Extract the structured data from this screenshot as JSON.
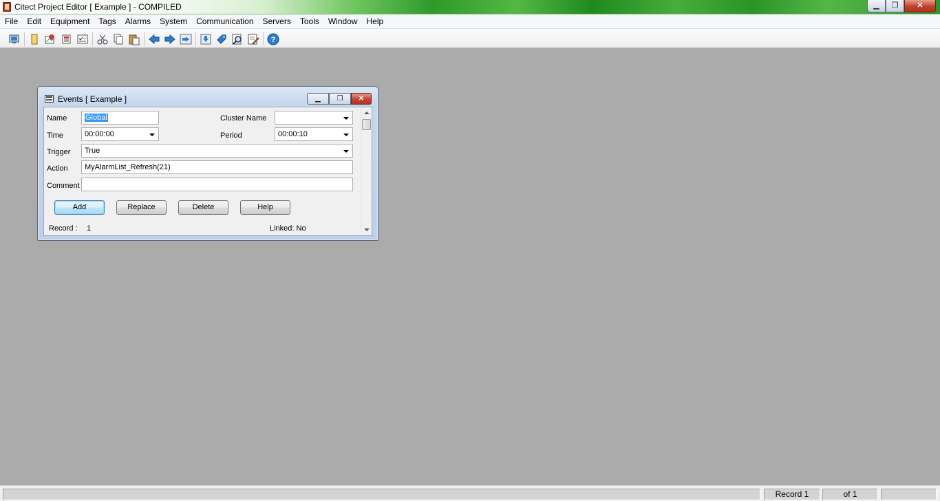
{
  "window": {
    "title": "Citect Project Editor [ Example ] - COMPILED",
    "minimize": "▁",
    "restore": "❐",
    "close": "✕"
  },
  "menu": [
    "File",
    "Edit",
    "Equipment",
    "Tags",
    "Alarms",
    "System",
    "Communication",
    "Servers",
    "Tools",
    "Window",
    "Help"
  ],
  "toolbar": {
    "buttons": [
      "explorer-icon",
      "open-project-icon",
      "graphics-builder-icon",
      "pack-icon",
      "compile-icon",
      "cut-icon",
      "copy-icon",
      "paste-icon",
      "back-arrow-icon",
      "forward-arrow-icon",
      "goto-arrow-icon",
      "download-icon",
      "tag-icon",
      "find-icon",
      "edit-icon",
      "help-icon"
    ],
    "accent": "#2a7fd4"
  },
  "events_form": {
    "title": "Events [ Example ]",
    "minimize": "▁",
    "restore": "❐",
    "close": "✕",
    "name_label": "Name",
    "name_value": "Global",
    "cluster_label": "Cluster Name",
    "cluster_value": "",
    "time_label": "Time",
    "time_value": "00:00:00",
    "period_label": "Period",
    "period_value": "00:00:10",
    "trigger_label": "Trigger",
    "trigger_value": "True",
    "action_label": "Action",
    "action_value": "MyAlarmList_Refresh(21)",
    "comment_label": "Comment",
    "comment_value": "",
    "add_label": "Add",
    "replace_label": "Replace",
    "delete_label": "Delete",
    "help_label": "Help",
    "record_label": "Record :",
    "record_value": "1",
    "linked_label": "Linked: No"
  },
  "status": {
    "main": "",
    "record": "Record 1",
    "of": "of 1",
    "extra": ""
  }
}
